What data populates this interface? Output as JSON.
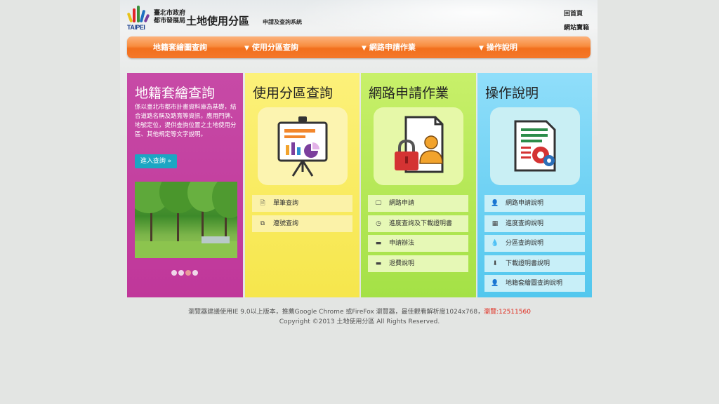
{
  "header": {
    "logo_text": "TAIPEI",
    "gov_line1": "臺北市政府",
    "gov_line2": "都市發展局",
    "title": "土地使用分區",
    "subtitle": "申請及查詢系統",
    "links": [
      "回首頁",
      "網站寶箱"
    ]
  },
  "nav": {
    "items": [
      "地籍套繪圖查詢",
      "使用分區查詢",
      "網路申請作業",
      "操作說明"
    ]
  },
  "col1": {
    "title": "地籍套繪查詢",
    "desc": "係以臺北市都市計畫資料庫為基礎，結合道路名稱及路寬等資訊，應用門牌、地號定位，提供查詢位置之土地使用分區、其他規定等文字說明。",
    "button": "進入查詢 »"
  },
  "col2": {
    "title": "使用分區查詢",
    "items": [
      {
        "icon": "document-icon",
        "glyph": "🗎",
        "label": "單筆查詢"
      },
      {
        "icon": "copy-icon",
        "glyph": "⧉",
        "label": "連號查詢"
      }
    ]
  },
  "col3": {
    "title": "網路申請作業",
    "items": [
      {
        "icon": "monitor-icon",
        "glyph": "🖵",
        "label": "網路申請"
      },
      {
        "icon": "clock-icon",
        "glyph": "◷",
        "label": "進度查詢及下載證明書"
      },
      {
        "icon": "comment-icon",
        "glyph": "▬",
        "label": "申請辦法"
      },
      {
        "icon": "comment-icon",
        "glyph": "▬",
        "label": "退費說明"
      }
    ]
  },
  "col4": {
    "title": "操作說明",
    "items": [
      {
        "icon": "user-icon",
        "glyph": "👤",
        "label": "網路申請說明"
      },
      {
        "icon": "calendar-icon",
        "glyph": "▦",
        "label": "進度查詢說明"
      },
      {
        "icon": "drop-icon",
        "glyph": "💧",
        "label": "分區查詢說明"
      },
      {
        "icon": "download-icon",
        "glyph": "⬇",
        "label": "下載證明書說明"
      },
      {
        "icon": "user-icon",
        "glyph": "👤",
        "label": "地籍套繪圖查詢說明"
      }
    ]
  },
  "footer": {
    "line1": "瀏覽器建議使用IE 9.0以上版本，推薦Google Chrome 或FireFox 瀏覽器，最佳觀看解析度1024x768，",
    "visit_label": "瀏覽:12511560",
    "line2": "Copyright ©2013 土地使用分區 All Rights Reserved."
  },
  "colors": {
    "nav_orange": "#f4782a",
    "col1": "#c0379a",
    "col2": "#f6e64c",
    "col3": "#a4e146",
    "col4": "#52c7ee"
  }
}
